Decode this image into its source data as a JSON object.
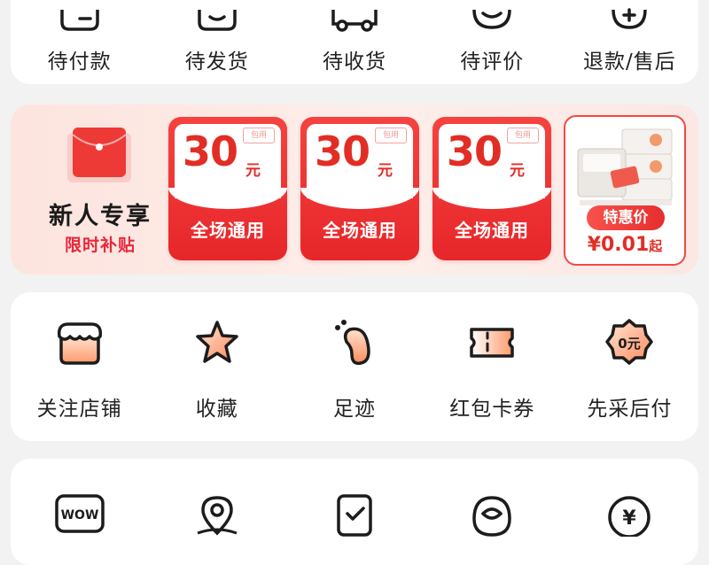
{
  "orders": {
    "items": [
      {
        "label": "待付款",
        "icon": "wallet-icon"
      },
      {
        "label": "待发货",
        "icon": "package-icon"
      },
      {
        "label": "待收货",
        "icon": "delivery-truck-icon"
      },
      {
        "label": "待评价",
        "icon": "review-chat-icon"
      },
      {
        "label": "退款/售后",
        "icon": "refund-icon"
      }
    ]
  },
  "promo": {
    "title": "新人专享",
    "subtitle": "限时补贴",
    "coupons": [
      {
        "amount": "30",
        "unit": "元",
        "tag": "包用",
        "scope": "全场通用"
      },
      {
        "amount": "30",
        "unit": "元",
        "tag": "包用",
        "scope": "全场通用"
      },
      {
        "amount": "30",
        "unit": "元",
        "tag": "包用",
        "scope": "全场通用"
      }
    ],
    "deal": {
      "badge": "特惠价",
      "price": "¥0.01",
      "price_suffix": "起"
    }
  },
  "shortcuts": {
    "items": [
      {
        "label": "关注店铺",
        "icon": "store-icon"
      },
      {
        "label": "收藏",
        "icon": "star-icon"
      },
      {
        "label": "足迹",
        "icon": "footprint-icon"
      },
      {
        "label": "红包卡券",
        "icon": "coupon-icon"
      },
      {
        "label": "先采后付",
        "icon": "pay-later-icon",
        "badge": "0元"
      }
    ]
  },
  "services": {
    "items": [
      {
        "icon": "wow-icon",
        "text": "WOW"
      },
      {
        "icon": "location-pin-icon"
      },
      {
        "icon": "checklist-icon"
      },
      {
        "icon": "customer-service-icon"
      },
      {
        "icon": "yuan-coin-icon",
        "text": "¥"
      }
    ]
  },
  "colors": {
    "accent": "#e8283a",
    "coupon_red": "#f0403c",
    "background": "#f2f2f2"
  }
}
